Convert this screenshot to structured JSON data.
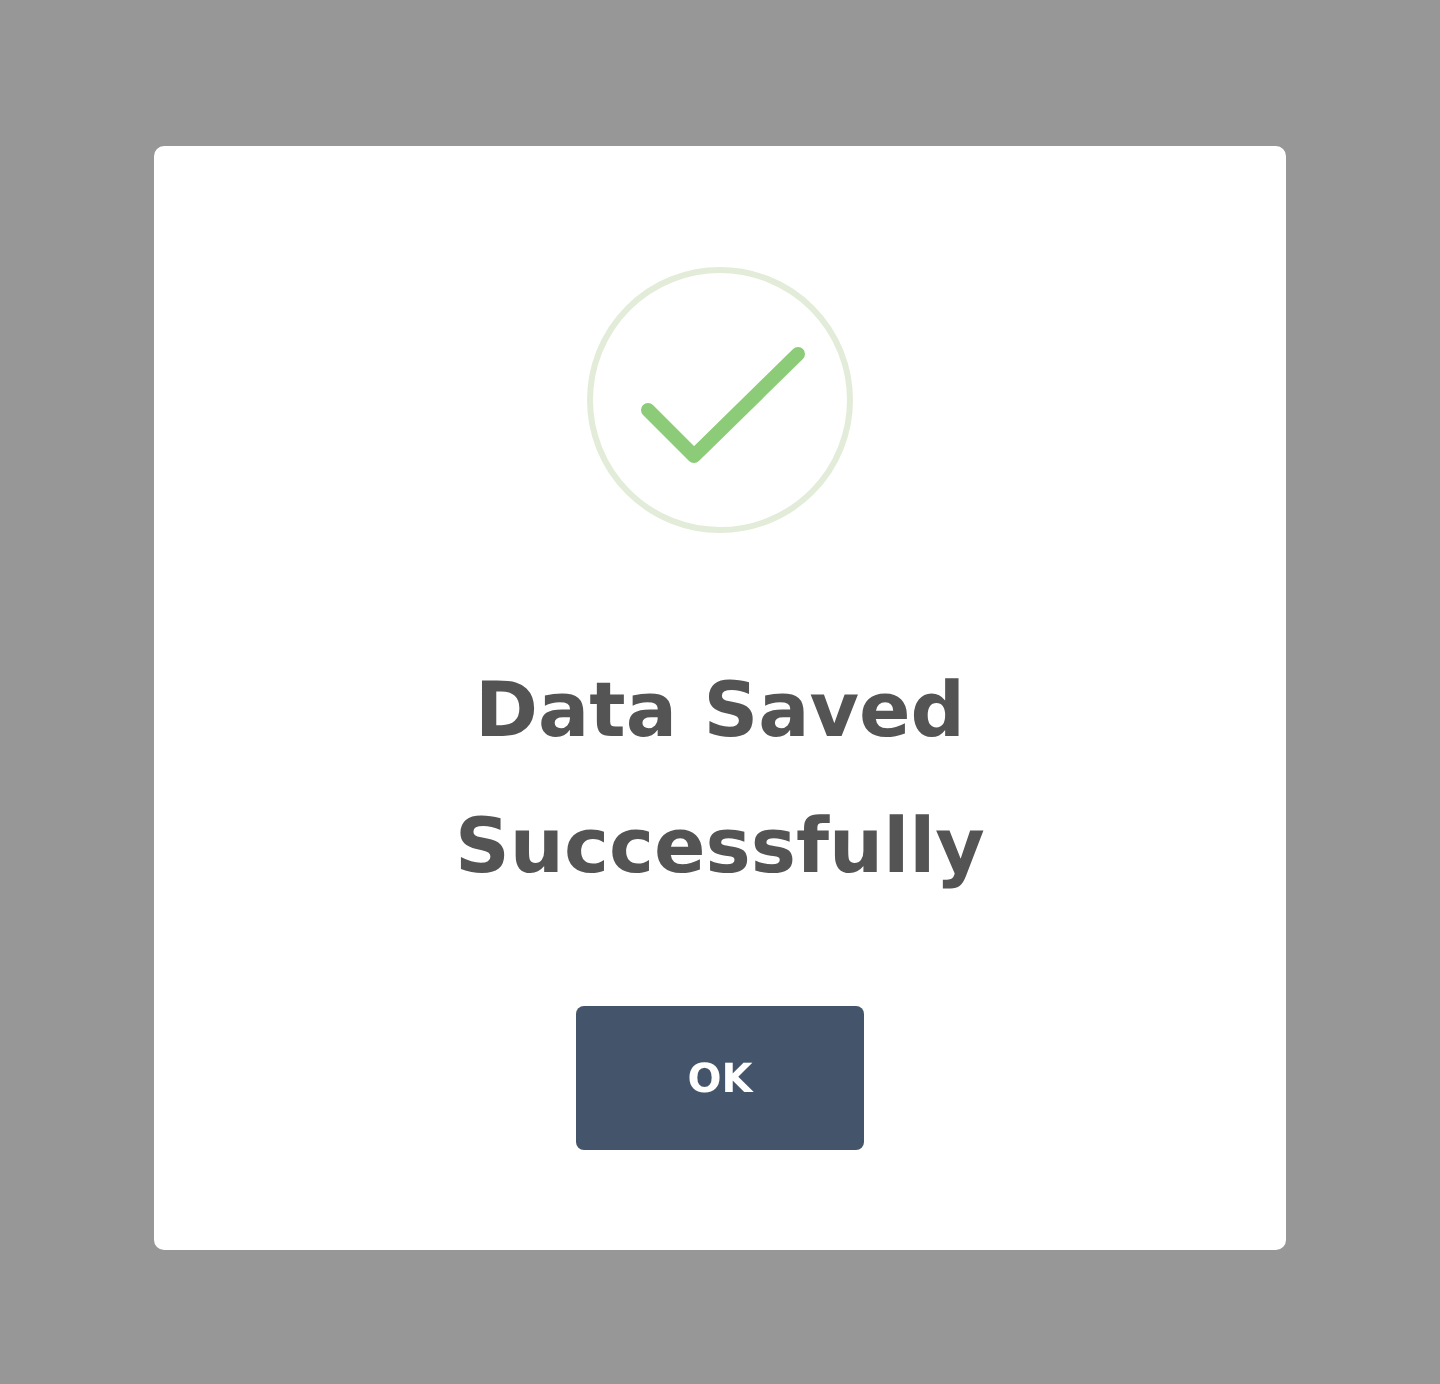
{
  "dialog": {
    "success": true,
    "title": "Data Saved Successfully",
    "button": "OK"
  }
}
